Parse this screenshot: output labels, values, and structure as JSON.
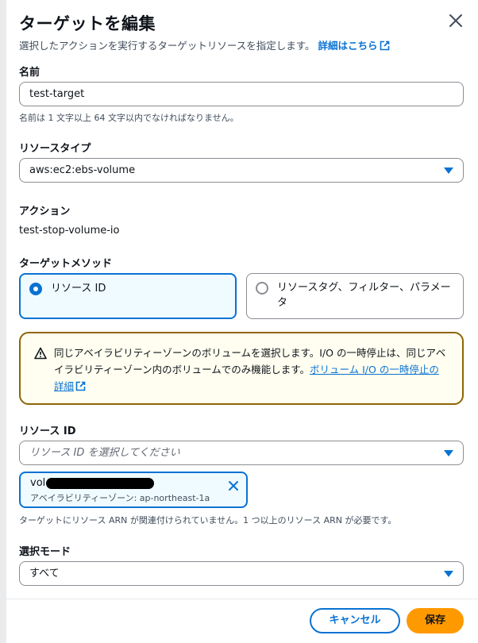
{
  "modal": {
    "title": "ターゲットを編集",
    "description": "選択したアクションを実行するターゲットリソースを指定します。",
    "learn_more": "詳細はこちら"
  },
  "name_field": {
    "label": "名前",
    "value": "test-target",
    "hint": "名前は 1 文字以上 64 文字以内でなければなりません。"
  },
  "resource_type": {
    "label": "リソースタイプ",
    "value": "aws:ec2:ebs-volume"
  },
  "action": {
    "label": "アクション",
    "value": "test-stop-volume-io"
  },
  "target_method": {
    "label": "ターゲットメソッド",
    "options": [
      {
        "label": "リソース ID",
        "selected": true
      },
      {
        "label": "リソースタグ、フィルター、パラメータ",
        "selected": false
      }
    ]
  },
  "alert": {
    "text": "同じアベイラビリティーゾーンのボリュームを選択します。I/O の一時停止は、同じアベイラビリティーゾーン内のボリュームでのみ機能します。",
    "link": "ボリューム I/O の一時停止の詳細"
  },
  "resource_id": {
    "label": "リソース ID",
    "placeholder": "リソース ID を選択してください",
    "token": {
      "value_prefix": "vol-",
      "sublabel": "アベイラビリティーゾーン: ap-northeast-1a"
    },
    "hint": "ターゲットにリソース ARN が関連付けられていません。1 つ以上のリソース ARN が必要です。"
  },
  "selection_mode": {
    "label": "選択モード",
    "value": "すべて"
  },
  "footer": {
    "cancel_label": "キャンセル",
    "save_label": "保存"
  },
  "colors": {
    "accent": "#0972d3",
    "primary_button": "#ff9900",
    "warning_border": "#8d6605",
    "warning_bg": "#fffef0"
  }
}
